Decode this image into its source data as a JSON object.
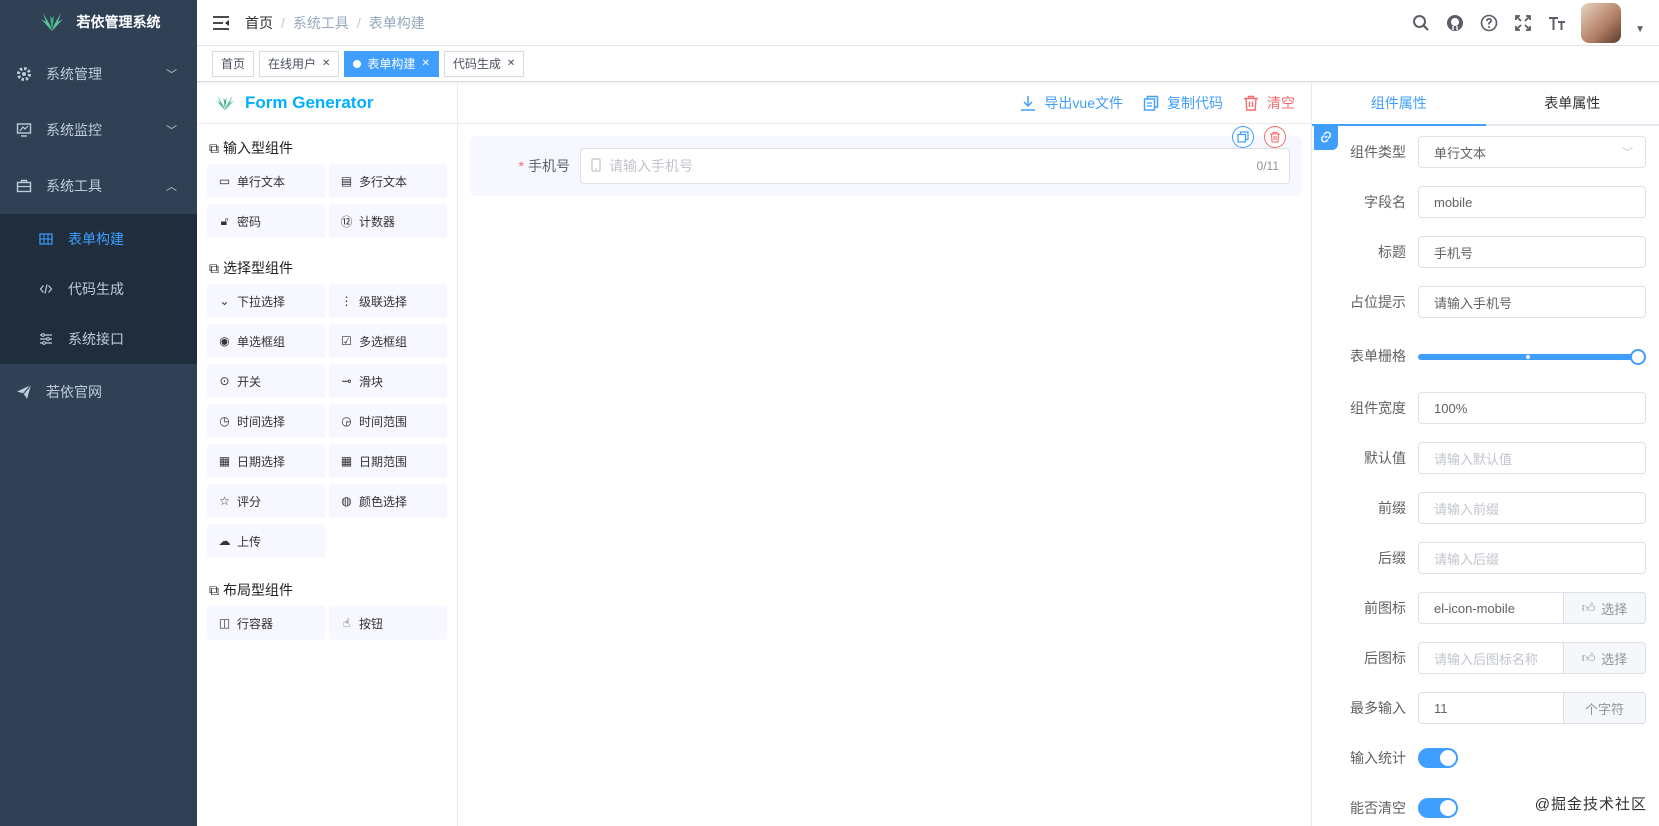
{
  "sidebar": {
    "title": "若依管理系统",
    "menus": [
      {
        "label": "系统管理"
      },
      {
        "label": "系统监控"
      },
      {
        "label": "系统工具"
      },
      {
        "label": "若依官网"
      }
    ],
    "submenu": [
      {
        "label": "表单构建"
      },
      {
        "label": "代码生成"
      },
      {
        "label": "系统接口"
      }
    ]
  },
  "navbar": {
    "breadcrumb": [
      "首页",
      "系统工具",
      "表单构建"
    ]
  },
  "tags": [
    {
      "label": "首页"
    },
    {
      "label": "在线用户"
    },
    {
      "label": "表单构建"
    },
    {
      "label": "代码生成"
    }
  ],
  "left_panel": {
    "logo_text": "Form Generator",
    "groups": [
      {
        "title": "输入型组件",
        "items": [
          "单行文本",
          "多行文本",
          "密码",
          "计数器"
        ]
      },
      {
        "title": "选择型组件",
        "items": [
          "下拉选择",
          "级联选择",
          "单选框组",
          "多选框组",
          "开关",
          "滑块",
          "时间选择",
          "时间范围",
          "日期选择",
          "日期范围",
          "评分",
          "颜色选择",
          "上传"
        ]
      },
      {
        "title": "布局型组件",
        "items": [
          "行容器",
          "按钮"
        ]
      }
    ]
  },
  "toolbar": {
    "export": "导出vue文件",
    "copy": "复制代码",
    "clear": "清空"
  },
  "canvas": {
    "field_label": "手机号",
    "placeholder": "请输入手机号",
    "count": "0/11"
  },
  "right_panel": {
    "tabs": [
      "组件属性",
      "表单属性"
    ],
    "props": {
      "type_label": "组件类型",
      "type_value": "单行文本",
      "field_label": "字段名",
      "field_value": "mobile",
      "title_label": "标题",
      "title_value": "手机号",
      "placeholder_label": "占位提示",
      "placeholder_value": "请输入手机号",
      "grid_label": "表单栅格",
      "grid_value": 24,
      "width_label": "组件宽度",
      "width_value": "100%",
      "default_label": "默认值",
      "default_ph": "请输入默认值",
      "prefix_label": "前缀",
      "prefix_ph": "请输入前缀",
      "suffix_label": "后缀",
      "suffix_ph": "请输入后缀",
      "prefix_icon_label": "前图标",
      "prefix_icon_value": "el-icon-mobile",
      "suffix_icon_label": "后图标",
      "suffix_icon_ph": "请输入后图标名称",
      "choose": "选择",
      "maxlen_label": "最多输入",
      "maxlen_value": "11",
      "maxlen_unit": "个字符",
      "show_count_label": "输入统计",
      "clearable_label": "能否清空"
    }
  },
  "watermark": "@掘金技术社区"
}
